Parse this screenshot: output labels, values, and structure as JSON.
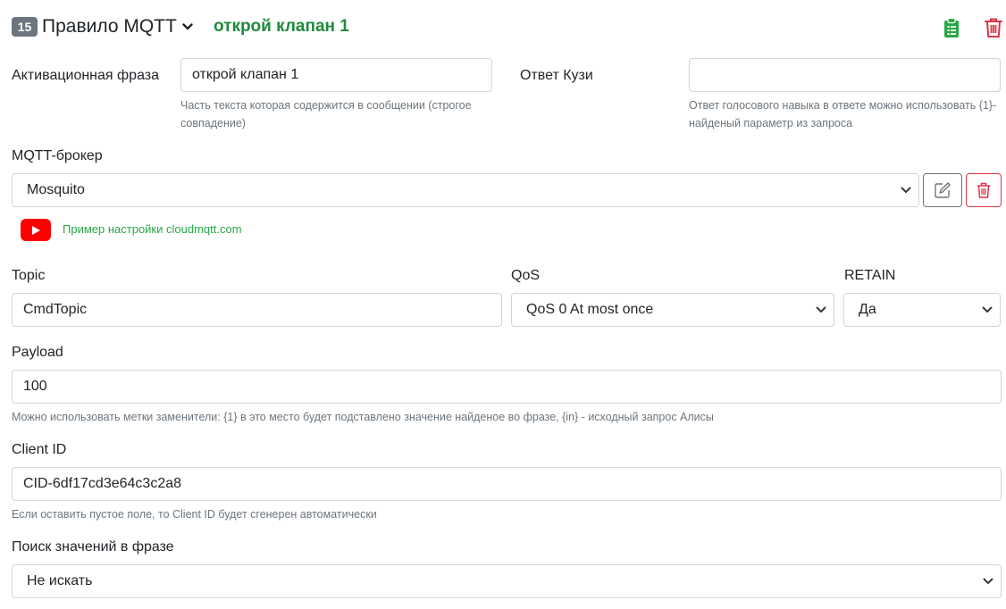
{
  "header": {
    "rule_number": "15",
    "rule_title": "Правило MQTT",
    "rule_phrase": "открой клапан 1",
    "icons": [
      "clipboard-icon",
      "trash-icon"
    ]
  },
  "activation": {
    "label": "Активационная фраза",
    "value": "открой клапан 1",
    "help": "Часть текста которая содержится в сообщении (строгое совпадение)"
  },
  "response": {
    "label": "Ответ Кузи",
    "value": "",
    "help": "Ответ голосового навыка в ответе можно использовать {1}- найденый параметр из запроса"
  },
  "broker": {
    "label": "MQTT-брокер",
    "selected": "Mosquito",
    "example_link": "Пример настройки cloudmqtt.com"
  },
  "topic": {
    "label": "Topic",
    "value": "CmdTopic"
  },
  "qos": {
    "label": "QoS",
    "selected": "QoS 0 At most once"
  },
  "retain": {
    "label": "RETAIN",
    "selected": "Да"
  },
  "payload": {
    "label": "Payload",
    "value": "100",
    "help": "Можно использовать метки заменители: {1} в это место будет подставлено значение найденое во фразе, {in} - исходный запрос Алисы"
  },
  "client_id": {
    "label": "Client ID",
    "value": "CID-6df17cd3e64c3c2a8",
    "help": "Если оставить пустое поле, то Client ID будет сгенерен автоматически"
  },
  "search": {
    "label": "Поиск значений в фразе",
    "selected": "Не искать"
  },
  "colors": {
    "accent_green": "#1e8a3e",
    "link_green": "#28a745",
    "danger": "#dc3545",
    "badge": "#6c757d",
    "youtube": "#ff0000"
  }
}
